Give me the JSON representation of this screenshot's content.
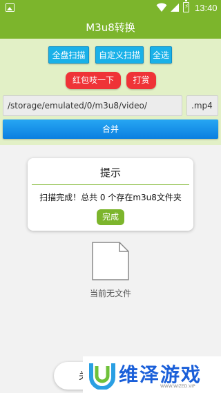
{
  "status_bar": {
    "time": "13:40",
    "battery_glyph": "⚡"
  },
  "app_bar": {
    "title": "M3u8转换"
  },
  "actions": {
    "scan_all": "全盘扫描",
    "custom_scan": "自定义扫描",
    "select_all": "全选",
    "red_packet": "红包吱一下",
    "tip": "打赏"
  },
  "path_input": {
    "value": "/storage/emulated/0/m3u8/video/"
  },
  "ext_input": {
    "value": ".mp4"
  },
  "merge_button": "合并",
  "dialog": {
    "title": "提示",
    "message": "扫描完成！总共 0 个存在m3u8文件夹",
    "ok": "完成"
  },
  "empty_state": {
    "text": "当前无文件"
  },
  "bottom_pill": {
    "label": "关"
  },
  "watermark": {
    "text": "维泽游戏",
    "subtext": "WWW.WIZED.VIP"
  },
  "colors": {
    "primary": "#7cb52c",
    "panel": "#e2f0c6",
    "blue": "#1ab1e8",
    "red": "#ef3337"
  },
  "icons": [
    "picture-icon",
    "wifi-icon",
    "signal-icon",
    "battery-icon",
    "file-icon",
    "watermark-logo-icon"
  ]
}
